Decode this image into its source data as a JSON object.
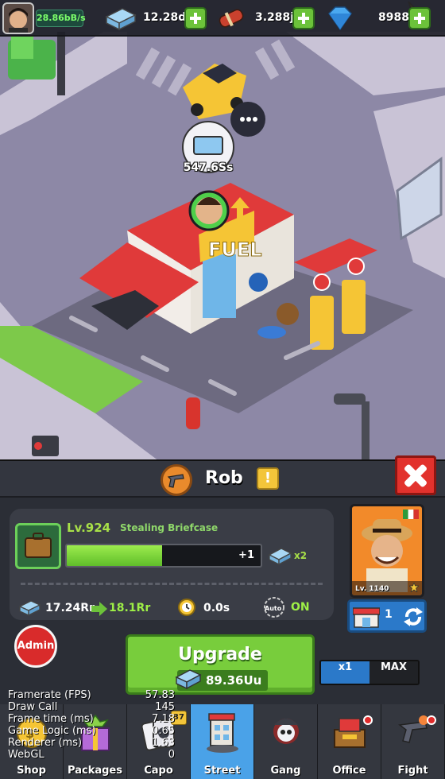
{
  "topbar": {
    "income_rate": "28.86bB/s",
    "cash": "12.28dD",
    "dynamite": "3.288jj",
    "diamonds": "8988"
  },
  "scene": {
    "building_sign": "FUEL",
    "price_label": "547.6Ss"
  },
  "panel": {
    "title": "Rob",
    "job": {
      "level": "Lv.924",
      "name": "Stealing Briefcase",
      "progress_fraction": 0.49,
      "progress_bonus": "+1",
      "multiplier": "x2"
    },
    "stats": {
      "income_current": "17.24Rr",
      "income_next": "18.1Rr",
      "time": "0.0s",
      "auto_label": "Auto",
      "auto_state": "ON"
    },
    "character": {
      "level": "Lv. 1140"
    },
    "building_count": "1",
    "admin_label": "Admin",
    "upgrade": {
      "label": "Upgrade",
      "cost": "89.36Uu"
    },
    "multiplier_options": [
      "x1",
      "MAX"
    ]
  },
  "debug": [
    {
      "key": "Framerate (FPS)",
      "value": "57.83"
    },
    {
      "key": "Draw Call",
      "value": "145"
    },
    {
      "key": "Frame time (ms)",
      "value": "7.18"
    },
    {
      "key": "Game Logic (ms)",
      "value": "0.65"
    },
    {
      "key": "Renderer (ms)",
      "value": "1.63"
    },
    {
      "key": "WebGL",
      "value": "0"
    }
  ],
  "nav": {
    "items": [
      {
        "label": "Shop"
      },
      {
        "label": "Packages"
      },
      {
        "label": "Capo",
        "badge": "37"
      },
      {
        "label": "Street"
      },
      {
        "label": "Gang"
      },
      {
        "label": "Office"
      },
      {
        "label": "Fight"
      }
    ]
  },
  "colors": {
    "accent_green": "#78cd3c",
    "close_red": "#e2322d",
    "active_tab": "#4aa2e8",
    "level_green": "#a8e048"
  }
}
